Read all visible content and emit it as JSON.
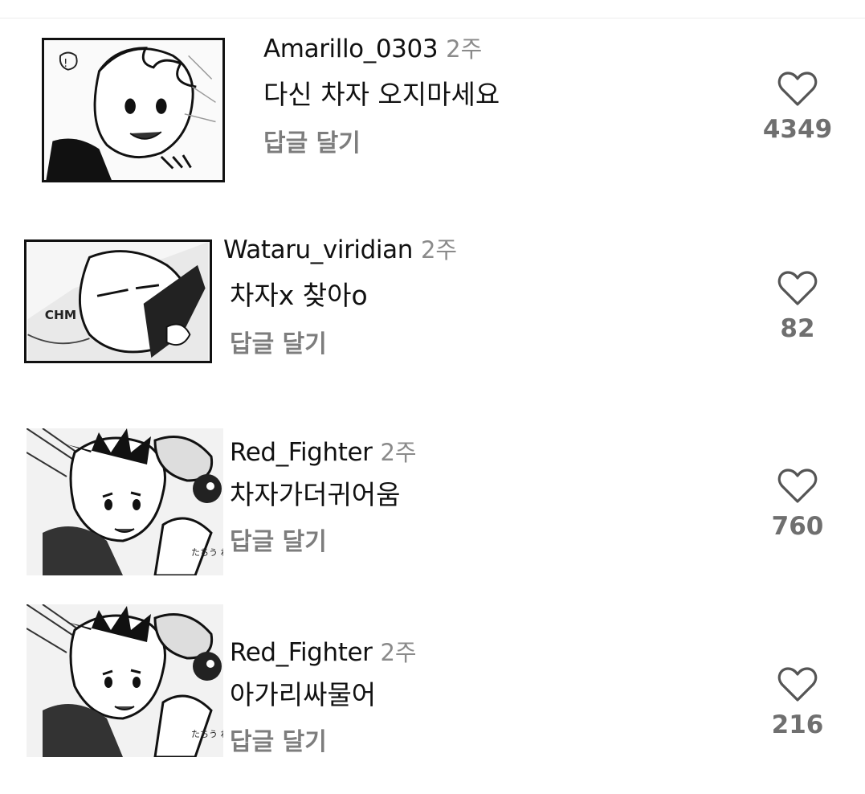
{
  "comments": [
    {
      "username": "Amarillo_0303",
      "time": "2주",
      "text": "다신 차자 오지마세요",
      "reply_label": "답글 달기",
      "likes": "4349",
      "avatar_icon": "manga-character-avatar"
    },
    {
      "username": "Wataru_viridian",
      "time": "2주",
      "text": "차자x 찾아o",
      "reply_label": "답글 달기",
      "likes": "82",
      "avatar_icon": "manga-character-avatar",
      "avatar_sfx": "CHM"
    },
    {
      "username": "Red_Fighter",
      "time": "2주",
      "text": "차자가더귀어움",
      "reply_label": "답글 달기",
      "likes": "760",
      "avatar_icon": "manga-character-avatar",
      "avatar_sfx": "たちう わしも"
    },
    {
      "username": "Red_Fighter",
      "time": "2주",
      "text": "아가리싸물어",
      "reply_label": "답글 달기",
      "likes": "216",
      "avatar_icon": "manga-character-avatar",
      "avatar_sfx": "たちう わしも"
    }
  ],
  "colors": {
    "username": "#111111",
    "time": "#8a8a8a",
    "reply": "#7d7d7d",
    "like_count": "#6f6f6f",
    "heart_stroke": "#555555"
  }
}
